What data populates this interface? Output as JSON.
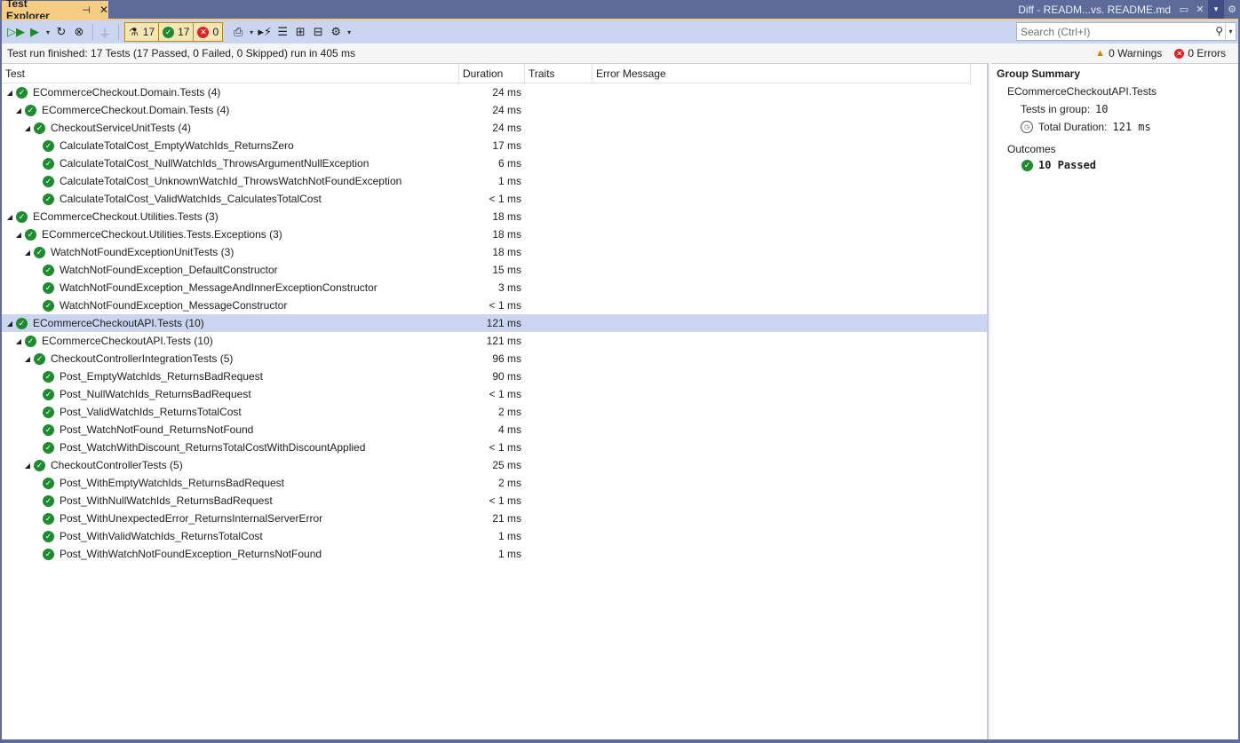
{
  "window": {
    "active_tab": "Test Explorer",
    "pin_glyph": "⊣",
    "close_glyph": "✕",
    "other_tab": "Diff - READM...vs. README.md",
    "other_tab_icons": [
      "pin-icon",
      "close-icon"
    ],
    "dropdown_glyph": "▾",
    "settings_glyph": "⚙"
  },
  "toolbar": {
    "counters": {
      "total": "17",
      "passed": "17",
      "failed": "0"
    },
    "search_placeholder": "Search (Ctrl+I)"
  },
  "status": {
    "message": "Test run finished: 17 Tests (17 Passed, 0 Failed, 0 Skipped) run in 405 ms",
    "warnings": "0 Warnings",
    "errors": "0 Errors"
  },
  "columns": {
    "test": "Test",
    "duration": "Duration",
    "traits": "Traits",
    "error": "Error Message"
  },
  "rows": [
    {
      "level": 0,
      "expandable": true,
      "label": "ECommerceCheckout.Domain.Tests  (4)",
      "duration": "24 ms"
    },
    {
      "level": 1,
      "expandable": true,
      "label": "ECommerceCheckout.Domain.Tests  (4)",
      "duration": "24 ms"
    },
    {
      "level": 2,
      "expandable": true,
      "label": "CheckoutServiceUnitTests  (4)",
      "duration": "24 ms"
    },
    {
      "level": 3,
      "expandable": false,
      "label": "CalculateTotalCost_EmptyWatchIds_ReturnsZero",
      "duration": "17 ms"
    },
    {
      "level": 3,
      "expandable": false,
      "label": "CalculateTotalCost_NullWatchIds_ThrowsArgumentNullException",
      "duration": "6 ms"
    },
    {
      "level": 3,
      "expandable": false,
      "label": "CalculateTotalCost_UnknownWatchId_ThrowsWatchNotFoundException",
      "duration": "1 ms"
    },
    {
      "level": 3,
      "expandable": false,
      "label": "CalculateTotalCost_ValidWatchIds_CalculatesTotalCost",
      "duration": "< 1 ms"
    },
    {
      "level": 0,
      "expandable": true,
      "label": "ECommerceCheckout.Utilities.Tests  (3)",
      "duration": "18 ms"
    },
    {
      "level": 1,
      "expandable": true,
      "label": "ECommerceCheckout.Utilities.Tests.Exceptions  (3)",
      "duration": "18 ms"
    },
    {
      "level": 2,
      "expandable": true,
      "label": "WatchNotFoundExceptionUnitTests  (3)",
      "duration": "18 ms"
    },
    {
      "level": 3,
      "expandable": false,
      "label": "WatchNotFoundException_DefaultConstructor",
      "duration": "15 ms"
    },
    {
      "level": 3,
      "expandable": false,
      "label": "WatchNotFoundException_MessageAndInnerExceptionConstructor",
      "duration": "3 ms"
    },
    {
      "level": 3,
      "expandable": false,
      "label": "WatchNotFoundException_MessageConstructor",
      "duration": "< 1 ms"
    },
    {
      "level": 0,
      "expandable": true,
      "label": "ECommerceCheckoutAPI.Tests  (10)",
      "duration": "121 ms",
      "selected": true
    },
    {
      "level": 1,
      "expandable": true,
      "label": "ECommerceCheckoutAPI.Tests  (10)",
      "duration": "121 ms"
    },
    {
      "level": 2,
      "expandable": true,
      "label": "CheckoutControllerIntegrationTests  (5)",
      "duration": "96 ms"
    },
    {
      "level": 3,
      "expandable": false,
      "label": "Post_EmptyWatchIds_ReturnsBadRequest",
      "duration": "90 ms"
    },
    {
      "level": 3,
      "expandable": false,
      "label": "Post_NullWatchIds_ReturnsBadRequest",
      "duration": "< 1 ms"
    },
    {
      "level": 3,
      "expandable": false,
      "label": "Post_ValidWatchIds_ReturnsTotalCost",
      "duration": "2 ms"
    },
    {
      "level": 3,
      "expandable": false,
      "label": "Post_WatchNotFound_ReturnsNotFound",
      "duration": "4 ms"
    },
    {
      "level": 3,
      "expandable": false,
      "label": "Post_WatchWithDiscount_ReturnsTotalCostWithDiscountApplied",
      "duration": "< 1 ms"
    },
    {
      "level": 2,
      "expandable": true,
      "label": "CheckoutControllerTests  (5)",
      "duration": "25 ms"
    },
    {
      "level": 3,
      "expandable": false,
      "label": "Post_WithEmptyWatchIds_ReturnsBadRequest",
      "duration": "2 ms"
    },
    {
      "level": 3,
      "expandable": false,
      "label": "Post_WithNullWatchIds_ReturnsBadRequest",
      "duration": "< 1 ms"
    },
    {
      "level": 3,
      "expandable": false,
      "label": "Post_WithUnexpectedError_ReturnsInternalServerError",
      "duration": "21 ms"
    },
    {
      "level": 3,
      "expandable": false,
      "label": "Post_WithValidWatchIds_ReturnsTotalCost",
      "duration": "1 ms"
    },
    {
      "level": 3,
      "expandable": false,
      "label": "Post_WithWatchNotFoundException_ReturnsNotFound",
      "duration": "1 ms"
    }
  ],
  "summary": {
    "title": "Group Summary",
    "group_name": "ECommerceCheckoutAPI.Tests",
    "tests_in_group_label": "Tests in group:",
    "tests_in_group_value": "10",
    "total_duration_label": "Total Duration:",
    "total_duration_value": "121 ms",
    "outcomes_label": "Outcomes",
    "passed_value": "10 Passed"
  },
  "colors": {
    "accent": "#f5cc84",
    "frame": "#5d6b99",
    "toolbar": "#ccd5f0",
    "pass": "#1f8a2f",
    "fail": "#d42929",
    "selection": "#ccd5f0"
  }
}
